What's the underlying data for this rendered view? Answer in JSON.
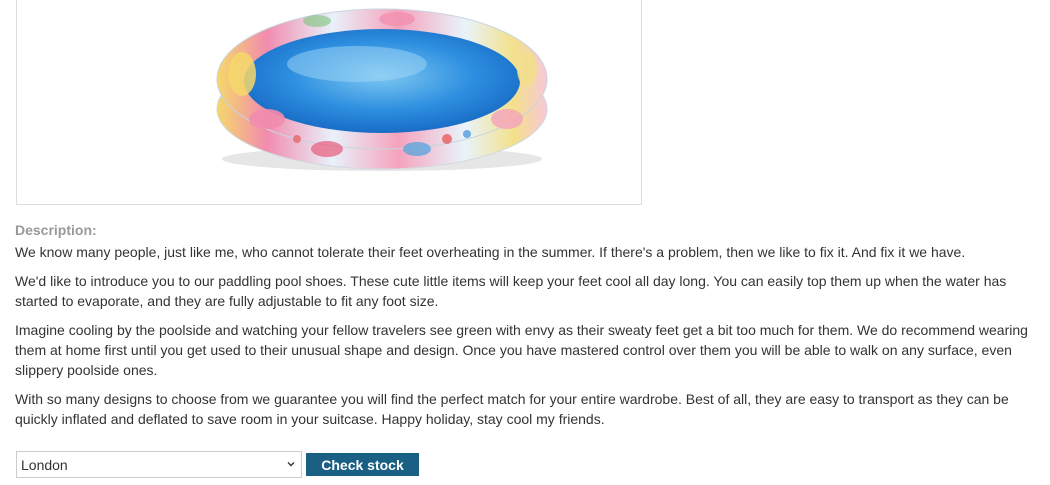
{
  "product": {
    "image_icon": "paddling-pool-image"
  },
  "description": {
    "heading": "Description:",
    "paragraphs": [
      "We know many people, just like me, who cannot tolerate their feet overheating in the summer. If there's a problem, then we like to fix it. And fix it we have.",
      "We'd like to introduce you to our paddling pool shoes. These cute little items will keep your feet cool all day long. You can easily top them up when the water has started to evaporate, and they are fully adjustable to fit any foot size.",
      "Imagine cooling by the poolside and watching your fellow travelers see green with envy as their sweaty feet get a bit too much for them. We do recommend wearing them at home first until you get used to their unusual shape and design. Once you have mastered control over them you will be able to walk on any surface, even slippery poolside ones.",
      "With so many designs to choose from we guarantee you will find the perfect match for your entire wardrobe. Best of all, they are easy to transport as they can be quickly inflated and deflated to save room in your suitcase. Happy holiday, stay cool my friends."
    ]
  },
  "stock": {
    "selected_store": "London",
    "button_label": "Check stock",
    "button_color": "#1a5f84"
  }
}
